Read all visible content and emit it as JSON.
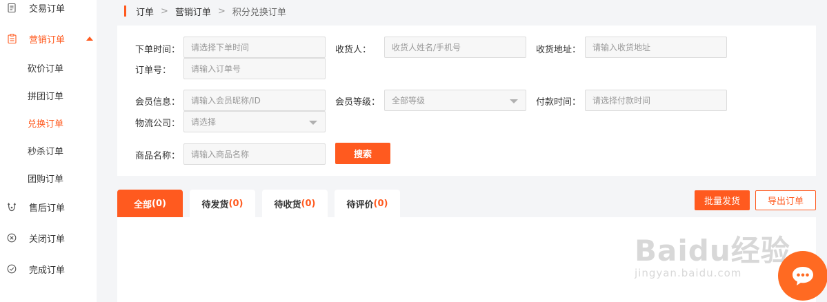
{
  "sidebar": {
    "items": [
      {
        "label": "交易订单",
        "icon": "document-icon"
      },
      {
        "label": "营销订单",
        "icon": "clipboard-icon"
      },
      {
        "label": "售后订单",
        "icon": "service-icon"
      },
      {
        "label": "关闭订单",
        "icon": "close-circle-icon"
      },
      {
        "label": "完成订单",
        "icon": "check-circle-icon"
      }
    ],
    "sub_items": [
      "砍价订单",
      "拼团订单",
      "兑换订单",
      "秒杀订单",
      "团购订单"
    ],
    "active_sub": "兑换订单"
  },
  "breadcrumb": [
    "订单",
    "营销订单",
    "积分兑换订单"
  ],
  "breadcrumb_sep": ">",
  "filter": {
    "order_time_label": "下单时间：",
    "order_time_placeholder": "请选择下单时间",
    "receiver_label": "收货人：",
    "receiver_placeholder": "收货人姓名/手机号",
    "address_label": "收货地址：",
    "address_placeholder": "请输入收货地址",
    "order_no_label": "订单号：",
    "order_no_placeholder": "请输入订单号",
    "member_info_label": "会员信息：",
    "member_info_placeholder": "请输入会员昵称/ID",
    "member_level_label": "会员等级：",
    "member_level_value": "全部等级",
    "pay_time_label": "付款时间：",
    "pay_time_placeholder": "请选择付款时间",
    "logistics_label": "物流公司：",
    "logistics_value": "请选择",
    "product_label": "商品名称：",
    "product_placeholder": "请输入商品名称",
    "search_label": "搜索"
  },
  "tabs": [
    {
      "label": "全部",
      "count": "(0)"
    },
    {
      "label": "待发货",
      "count": "(0)"
    },
    {
      "label": "待收货",
      "count": "(0)"
    },
    {
      "label": "待评价",
      "count": "(0)"
    }
  ],
  "actions": {
    "batch_ship": "批量发货",
    "export": "导出订单"
  },
  "watermark": {
    "brand": "Baidu经验",
    "url": "jingyan.baidu.com"
  },
  "colors": {
    "accent": "#ff5a1f",
    "chat": "#ff6a22"
  }
}
